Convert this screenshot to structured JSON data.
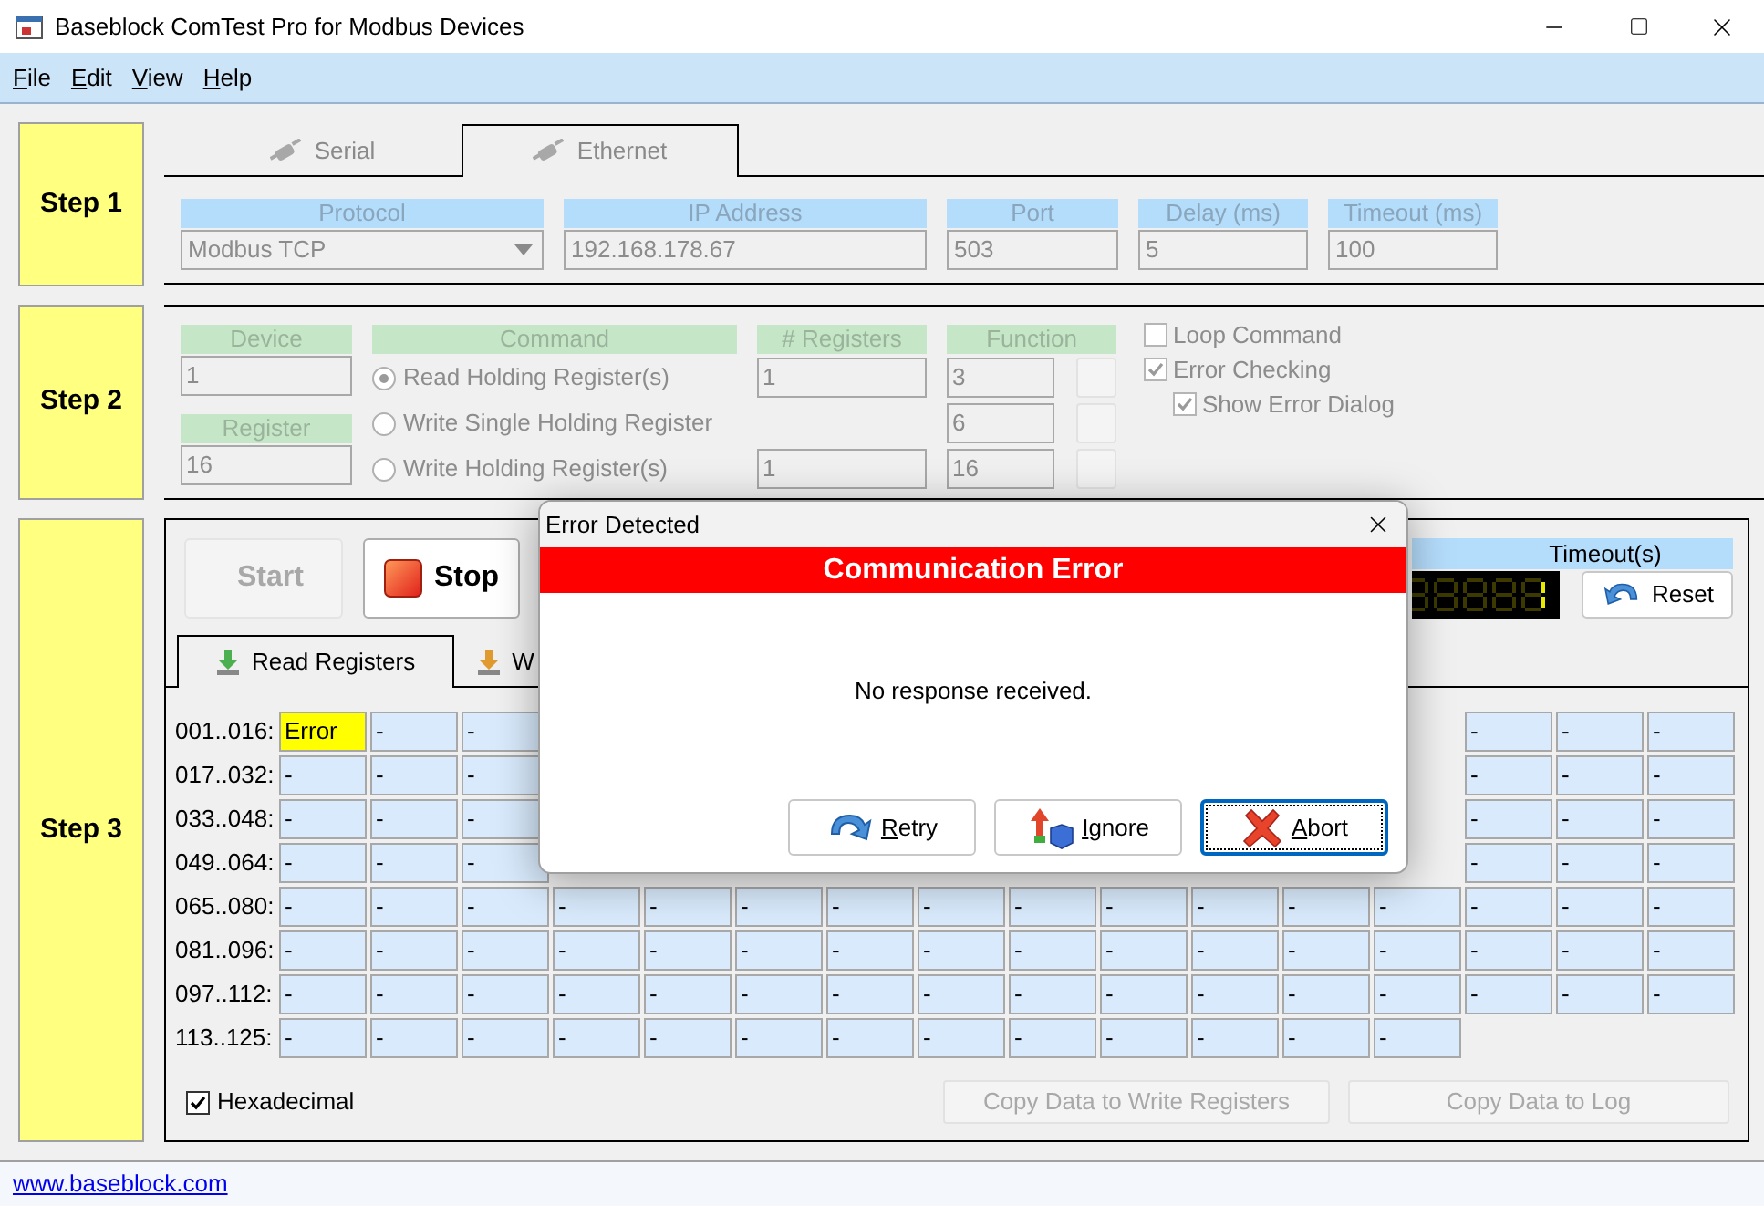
{
  "window": {
    "title": "Baseblock ComTest Pro for Modbus Devices"
  },
  "menu": [
    {
      "mnemonic": "F",
      "rest": "ile"
    },
    {
      "mnemonic": "E",
      "rest": "dit"
    },
    {
      "mnemonic": "V",
      "rest": "iew"
    },
    {
      "mnemonic": "H",
      "rest": "elp"
    }
  ],
  "step1": {
    "label": "Step 1",
    "disabled": true,
    "tabs": [
      {
        "label": "Serial",
        "selected": false
      },
      {
        "label": "Ethernet",
        "selected": true
      }
    ],
    "fields": [
      {
        "label": "Protocol",
        "value": "Modbus TCP",
        "kind": "dropdown"
      },
      {
        "label": "IP Address",
        "value": "192.168.178.67",
        "kind": "text"
      },
      {
        "label": "Port",
        "value": "503",
        "kind": "text"
      },
      {
        "label": "Delay (ms)",
        "value": "5",
        "kind": "text"
      },
      {
        "label": "Timeout (ms)",
        "value": "100",
        "kind": "text"
      }
    ]
  },
  "step2": {
    "label": "Step 2",
    "disabled": true,
    "device": {
      "label": "Device",
      "value": "1"
    },
    "register": {
      "label": "Register",
      "value": "16"
    },
    "command_header": "Command",
    "registers_header": "# Registers",
    "function_header": "Function",
    "commands": [
      {
        "label": "Read Holding Register(s)",
        "selected": true,
        "registers": "1",
        "function": "3"
      },
      {
        "label": "Write Single Holding Register",
        "selected": false,
        "function": "6"
      },
      {
        "label": "Write Holding Register(s)",
        "selected": false,
        "registers": "1",
        "function": "16"
      }
    ],
    "options": [
      {
        "label": "Loop Command",
        "checked": false
      },
      {
        "label": "Error Checking",
        "checked": true,
        "children": [
          {
            "label": "Show Error Dialog",
            "checked": true
          }
        ]
      }
    ]
  },
  "step3": {
    "label": "Step 3",
    "start": {
      "label": "Start",
      "disabled": true
    },
    "stop": {
      "label": "Stop",
      "disabled": false
    },
    "timeout_label": "Timeout(s)",
    "reset": {
      "label": "Reset"
    },
    "tabs": [
      {
        "label": "Read Registers",
        "selected": true
      },
      {
        "label": "W",
        "selected": false
      }
    ],
    "rows": [
      {
        "label": "001..016:",
        "cells_left": [
          {
            "text": "Error",
            "kind": "error"
          },
          {
            "text": "-",
            "kind": "value"
          },
          {
            "text": "-",
            "kind": "value"
          }
        ],
        "cells_right": [
          {
            "text": "-",
            "kind": "value"
          },
          {
            "text": "-",
            "kind": "value"
          },
          {
            "text": "-",
            "kind": "value"
          }
        ]
      },
      {
        "label": "017..032:",
        "cells_left": [
          {
            "text": "-",
            "kind": "value"
          },
          {
            "text": "-",
            "kind": "value"
          },
          {
            "text": "-",
            "kind": "value"
          }
        ],
        "cells_right": [
          {
            "text": "-",
            "kind": "value"
          },
          {
            "text": "-",
            "kind": "value"
          },
          {
            "text": "-",
            "kind": "value"
          }
        ]
      },
      {
        "label": "033..048:",
        "cells_left": [
          {
            "text": "-",
            "kind": "value"
          },
          {
            "text": "-",
            "kind": "value"
          },
          {
            "text": "-",
            "kind": "value"
          }
        ],
        "cells_right": [
          {
            "text": "-",
            "kind": "value"
          },
          {
            "text": "-",
            "kind": "value"
          },
          {
            "text": "-",
            "kind": "value"
          }
        ]
      },
      {
        "label": "049..064:",
        "cells_left": [
          {
            "text": "-",
            "kind": "value"
          },
          {
            "text": "-",
            "kind": "value"
          },
          {
            "text": "-",
            "kind": "value"
          }
        ],
        "cells_right": [
          {
            "text": "-",
            "kind": "value"
          },
          {
            "text": "-",
            "kind": "value"
          },
          {
            "text": "-",
            "kind": "value"
          }
        ]
      },
      {
        "label": "065..080:",
        "cells": [
          {
            "text": "-",
            "kind": "value"
          },
          {
            "text": "-",
            "kind": "value"
          },
          {
            "text": "-",
            "kind": "value"
          },
          {
            "text": "-",
            "kind": "value"
          },
          {
            "text": "-",
            "kind": "value"
          },
          {
            "text": "-",
            "kind": "value"
          },
          {
            "text": "-",
            "kind": "value"
          },
          {
            "text": "-",
            "kind": "value"
          },
          {
            "text": "-",
            "kind": "value"
          },
          {
            "text": "-",
            "kind": "value"
          },
          {
            "text": "-",
            "kind": "value"
          },
          {
            "text": "-",
            "kind": "value"
          },
          {
            "text": "-",
            "kind": "value"
          },
          {
            "text": "-",
            "kind": "value"
          },
          {
            "text": "-",
            "kind": "value"
          },
          {
            "text": "-",
            "kind": "value"
          }
        ]
      },
      {
        "label": "081..096:",
        "cells": [
          {
            "text": "-",
            "kind": "value"
          },
          {
            "text": "-",
            "kind": "value"
          },
          {
            "text": "-",
            "kind": "value"
          },
          {
            "text": "-",
            "kind": "value"
          },
          {
            "text": "-",
            "kind": "value"
          },
          {
            "text": "-",
            "kind": "value"
          },
          {
            "text": "-",
            "kind": "value"
          },
          {
            "text": "-",
            "kind": "value"
          },
          {
            "text": "-",
            "kind": "value"
          },
          {
            "text": "-",
            "kind": "value"
          },
          {
            "text": "-",
            "kind": "value"
          },
          {
            "text": "-",
            "kind": "value"
          },
          {
            "text": "-",
            "kind": "value"
          },
          {
            "text": "-",
            "kind": "value"
          },
          {
            "text": "-",
            "kind": "value"
          },
          {
            "text": "-",
            "kind": "value"
          }
        ]
      },
      {
        "label": "097..112:",
        "cells": [
          {
            "text": "-",
            "kind": "value"
          },
          {
            "text": "-",
            "kind": "value"
          },
          {
            "text": "-",
            "kind": "value"
          },
          {
            "text": "-",
            "kind": "value"
          },
          {
            "text": "-",
            "kind": "value"
          },
          {
            "text": "-",
            "kind": "value"
          },
          {
            "text": "-",
            "kind": "value"
          },
          {
            "text": "-",
            "kind": "value"
          },
          {
            "text": "-",
            "kind": "value"
          },
          {
            "text": "-",
            "kind": "value"
          },
          {
            "text": "-",
            "kind": "value"
          },
          {
            "text": "-",
            "kind": "value"
          },
          {
            "text": "-",
            "kind": "value"
          },
          {
            "text": "-",
            "kind": "value"
          },
          {
            "text": "-",
            "kind": "value"
          },
          {
            "text": "-",
            "kind": "value"
          }
        ]
      },
      {
        "label": "113..125:",
        "cells": [
          {
            "text": "-",
            "kind": "value"
          },
          {
            "text": "-",
            "kind": "value"
          },
          {
            "text": "-",
            "kind": "value"
          },
          {
            "text": "-",
            "kind": "value"
          },
          {
            "text": "-",
            "kind": "value"
          },
          {
            "text": "-",
            "kind": "value"
          },
          {
            "text": "-",
            "kind": "value"
          },
          {
            "text": "-",
            "kind": "value"
          },
          {
            "text": "-",
            "kind": "value"
          },
          {
            "text": "-",
            "kind": "value"
          },
          {
            "text": "-",
            "kind": "value"
          },
          {
            "text": "-",
            "kind": "value"
          },
          {
            "text": "-",
            "kind": "value"
          }
        ]
      }
    ],
    "hexadecimal": {
      "label": "Hexadecimal",
      "checked": true
    },
    "buttons": [
      {
        "label": "Copy Data to Write Registers",
        "disabled": true
      },
      {
        "label": "Copy Data to Log",
        "disabled": true
      }
    ]
  },
  "footer": {
    "link": "www.baseblock.com"
  },
  "dialog": {
    "title": "Error Detected",
    "banner": "Communication Error",
    "message": "No response received.",
    "buttons": [
      {
        "mnemonic": "R",
        "rest": "etry",
        "kind": "retry",
        "focused": false
      },
      {
        "mnemonic": "I",
        "rest": "gnore",
        "kind": "ignore",
        "focused": false
      },
      {
        "mnemonic": "A",
        "rest": "bort",
        "kind": "abort",
        "focused": true
      }
    ]
  }
}
